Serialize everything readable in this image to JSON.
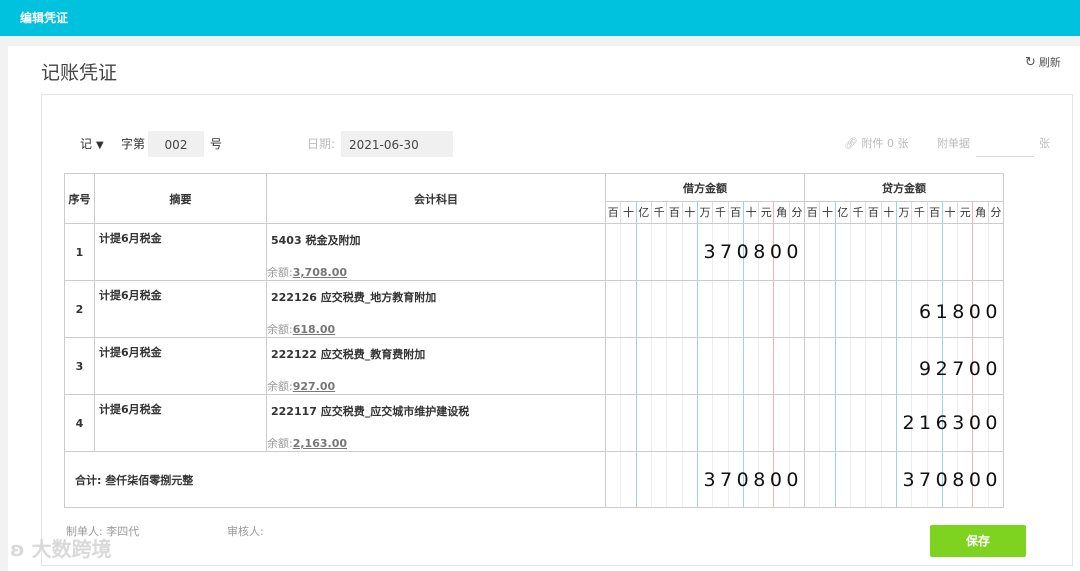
{
  "topbar": {
    "title": "编辑凭证"
  },
  "page": {
    "title": "记账凭证",
    "refresh_label": "刷新"
  },
  "voucher": {
    "type": "记",
    "word_label": "字第",
    "number": "002",
    "number_suffix": "号",
    "date_label": "日期:",
    "date_value": "2021-06-30",
    "attachment_label": "附件 0 张",
    "receipts_label": "附单据",
    "receipts_unit": "张"
  },
  "table": {
    "headers": {
      "seq": "序号",
      "summary": "摘要",
      "account": "会计科目",
      "debit": "借方金额",
      "credit": "贷方金额"
    },
    "digit_units": [
      "百",
      "十",
      "亿",
      "千",
      "百",
      "十",
      "万",
      "千",
      "百",
      "十",
      "元",
      "角",
      "分"
    ],
    "balance_label": "余额:",
    "rows": [
      {
        "seq": "1",
        "summary": "计提6月税金",
        "account": "5403 税金及附加",
        "balance": "3,708.00",
        "debit": "370800",
        "credit": ""
      },
      {
        "seq": "2",
        "summary": "计提6月税金",
        "account": "222126 应交税费_地方教育附加",
        "balance": "618.00",
        "debit": "",
        "credit": "61800"
      },
      {
        "seq": "3",
        "summary": "计提6月税金",
        "account": "222122 应交税费_教育费附加",
        "balance": "927.00",
        "debit": "",
        "credit": "92700"
      },
      {
        "seq": "4",
        "summary": "计提6月税金",
        "account": "222117 应交税费_应交城市维护建设税",
        "balance": "2,163.00",
        "debit": "",
        "credit": "216300"
      }
    ],
    "total": {
      "label": "合计:",
      "words": "叁仟柒佰零捌元整",
      "debit": "370800",
      "credit": "370800"
    }
  },
  "footer": {
    "maker_label": "制单人:",
    "maker": "李四代",
    "reviewer_label": "审核人:"
  },
  "actions": {
    "save_label": "保存"
  },
  "watermark": {
    "text": "大数跨境"
  },
  "colors": {
    "topbar": "#00c1de",
    "save": "#7ed321",
    "ten_thousand_line": "#9ed2ea",
    "yuan_line": "#f4b4b4"
  }
}
